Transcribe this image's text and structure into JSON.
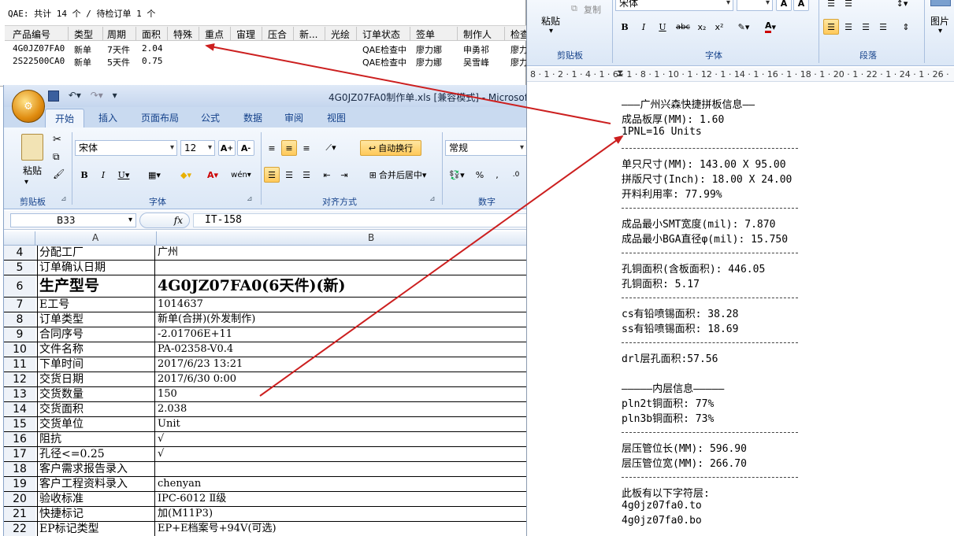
{
  "qae": {
    "title": "QAE: 共计 14 个 / 待检订单 1 个",
    "columns": [
      "产品编号",
      "类型",
      "周期",
      "面积",
      "特殊",
      "重点",
      "宙理",
      "压合",
      "新...",
      "光绘",
      "订单状态",
      "签单",
      "制作人",
      "检查"
    ],
    "rows": [
      [
        "4G0JZ07FA0",
        "新单",
        "7天件",
        "2.04",
        "",
        "",
        "",
        "",
        "",
        "",
        "QAE检查中",
        "廖力娜",
        "申勇祁",
        "廖力"
      ],
      [
        "2S22500CA0",
        "新单",
        "5天件",
        "0.75",
        "",
        "",
        "",
        "",
        "",
        "",
        "QAE检查中",
        "廖力娜",
        "吴雪峰",
        "廖力"
      ]
    ]
  },
  "excel": {
    "title": "4G0JZ07FA0制作单.xls [兼容模式] - Microsoft Excel",
    "tabs": [
      "开始",
      "插入",
      "页面布局",
      "公式",
      "数据",
      "审阅",
      "视图"
    ],
    "font_name": "宋体",
    "font_size": "12",
    "number_format": "常规",
    "wrap_text": "自动换行",
    "merge_center": "合并后居中",
    "paste_label": "粘贴",
    "group_labels": [
      "剪贴板",
      "字体",
      "对齐方式",
      "数字"
    ],
    "name_box": "B33",
    "fx_label": "fx",
    "formula": "IT-158",
    "col_a": "A",
    "col_b": "B",
    "rows": [
      {
        "n": "4",
        "a": "分配工厂",
        "b": "广州"
      },
      {
        "n": "5",
        "a": "订单确认日期",
        "b": ""
      },
      {
        "n": "6",
        "a": "生产型号",
        "b": "4G0JZ07FA0(6天件)(新)"
      },
      {
        "n": "7",
        "a": "E工号",
        "b": "1014637"
      },
      {
        "n": "8",
        "a": "订单类型",
        "b": "新单(合拼)(外发制作)"
      },
      {
        "n": "9",
        "a": "合同序号",
        "b": "-2.01706E+11"
      },
      {
        "n": "10",
        "a": "文件名称",
        "b": "PA-02358-V0.4"
      },
      {
        "n": "11",
        "a": "下单时间",
        "b": "2017/6/23 13:21"
      },
      {
        "n": "12",
        "a": "交货日期",
        "b": "2017/6/30 0:00"
      },
      {
        "n": "13",
        "a": "交货数量",
        "b": "150"
      },
      {
        "n": "14",
        "a": "交货面积",
        "b": "2.038"
      },
      {
        "n": "15",
        "a": "交货单位",
        "b": "Unit"
      },
      {
        "n": "16",
        "a": "阻抗",
        "b": "√"
      },
      {
        "n": "17",
        "a": "孔径<=0.25",
        "b": "√"
      },
      {
        "n": "18",
        "a": "客户需求报告录入",
        "b": ""
      },
      {
        "n": "19",
        "a": "客户工程资料录入",
        "b": "chenyan"
      },
      {
        "n": "20",
        "a": "验收标准",
        "b": "IPC-6012 Ⅱ级"
      },
      {
        "n": "21",
        "a": "快捷标记",
        "b": "加(M11P3)"
      },
      {
        "n": "22",
        "a": "EP标记类型",
        "b": "EP+E档案号+94V(可选)"
      }
    ]
  },
  "word": {
    "ribbon": {
      "paste": "粘贴",
      "copy": "复制",
      "font_name": "宋体",
      "group_clipboard": "剪贴板",
      "group_font": "字体",
      "group_paragraph": "段落",
      "picture": "图片"
    },
    "ruler": "8 · 1 · 2 · 1 · 4 · 1 · 6 · 1 · 8 · 1 · 10 · 1 · 12 · 1 · 14 · 1 · 16 · 1 · 18 · 1 · 20 · 1 · 22 · 1 · 24 · 1 · 26 · 1 · 28",
    "lines": [
      "———广州兴森快捷拼板信息——",
      "成品板厚(MM): 1.60",
      "1PNL=16 Units",
      "",
      "单只尺寸(MM): 143.00 X 95.00",
      "拼版尺寸(Inch): 18.00 X 24.00",
      "开料利用率: 77.99%",
      "",
      "成品最小SMT宽度(mil): 7.870",
      "成品最小BGA直径φ(mil): 15.750",
      "",
      "孔铜面积(含板面积): 446.05",
      "孔铜面积: 5.17",
      "",
      "cs有铅喷锡面积: 38.28",
      "ss有铅喷锡面积: 18.69",
      "",
      "drl层孔面积:57.56",
      "",
      "—————内层信息—————",
      "pln2t铜面积: 77%",
      "pln3b铜面积: 73%",
      "",
      "层压管位长(MM): 596.90",
      "层压管位宽(MM): 266.70",
      "",
      "此板有以下字符层:",
      "4g0jz07fa0.to",
      "4g0jz07fa0.bo"
    ]
  },
  "colors": {
    "arrow": "#cc1f1f",
    "excel_tab": "#c9daf0",
    "ribbon_text": "#15428b"
  }
}
